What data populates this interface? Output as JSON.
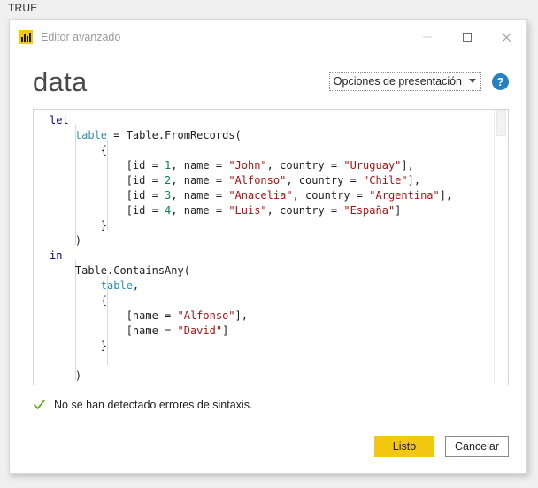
{
  "background": {
    "label": "TRUE"
  },
  "window": {
    "app_icon": "power-bi-bar-chart-icon",
    "title": "Editor avanzado",
    "controls": {
      "minimize": "minimize-icon",
      "maximize": "maximize-icon",
      "close": "close-icon"
    }
  },
  "header": {
    "title": "data",
    "display_options": {
      "label": "Opciones de presentación",
      "caret": "chevron-down-icon"
    },
    "help": {
      "glyph": "?",
      "name": "help-icon"
    }
  },
  "editor": {
    "language": "Power Query M",
    "code_lines": [
      [
        {
          "t": "let",
          "c": "kw"
        }
      ],
      [
        {
          "t": "    ",
          "c": "pl"
        },
        {
          "t": "table",
          "c": "id"
        },
        {
          "t": " = Table.FromRecords(",
          "c": "fn"
        }
      ],
      [
        {
          "t": "        {",
          "c": "pl"
        }
      ],
      [
        {
          "t": "            [id = ",
          "c": "pl"
        },
        {
          "t": "1",
          "c": "num"
        },
        {
          "t": ", name = ",
          "c": "pl"
        },
        {
          "t": "\"John\"",
          "c": "str"
        },
        {
          "t": ", country = ",
          "c": "pl"
        },
        {
          "t": "\"Uruguay\"",
          "c": "str"
        },
        {
          "t": "],",
          "c": "pl"
        }
      ],
      [
        {
          "t": "            [id = ",
          "c": "pl"
        },
        {
          "t": "2",
          "c": "num"
        },
        {
          "t": ", name = ",
          "c": "pl"
        },
        {
          "t": "\"Alfonso\"",
          "c": "str"
        },
        {
          "t": ", country = ",
          "c": "pl"
        },
        {
          "t": "\"Chile\"",
          "c": "str"
        },
        {
          "t": "],",
          "c": "pl"
        }
      ],
      [
        {
          "t": "            [id = ",
          "c": "pl"
        },
        {
          "t": "3",
          "c": "num"
        },
        {
          "t": ", name = ",
          "c": "pl"
        },
        {
          "t": "\"Anacelia\"",
          "c": "str"
        },
        {
          "t": ", country = ",
          "c": "pl"
        },
        {
          "t": "\"Argentina\"",
          "c": "str"
        },
        {
          "t": "],",
          "c": "pl"
        }
      ],
      [
        {
          "t": "            [id = ",
          "c": "pl"
        },
        {
          "t": "4",
          "c": "num"
        },
        {
          "t": ", name = ",
          "c": "pl"
        },
        {
          "t": "\"Luis\"",
          "c": "str"
        },
        {
          "t": ", country = ",
          "c": "pl"
        },
        {
          "t": "\"España\"",
          "c": "str"
        },
        {
          "t": "]",
          "c": "pl"
        }
      ],
      [
        {
          "t": "        }",
          "c": "pl"
        }
      ],
      [
        {
          "t": "    )",
          "c": "pl"
        }
      ],
      [
        {
          "t": "in",
          "c": "kw"
        }
      ],
      [
        {
          "t": "    Table.ContainsAny(",
          "c": "fn"
        }
      ],
      [
        {
          "t": "        ",
          "c": "pl"
        },
        {
          "t": "table",
          "c": "id"
        },
        {
          "t": ",",
          "c": "pl"
        }
      ],
      [
        {
          "t": "        {",
          "c": "pl"
        }
      ],
      [
        {
          "t": "            [name = ",
          "c": "pl"
        },
        {
          "t": "\"Alfonso\"",
          "c": "str"
        },
        {
          "t": "],",
          "c": "pl"
        }
      ],
      [
        {
          "t": "            [name = ",
          "c": "pl"
        },
        {
          "t": "\"David\"",
          "c": "str"
        },
        {
          "t": "]",
          "c": "pl"
        }
      ],
      [
        {
          "t": "        }",
          "c": "pl"
        }
      ],
      [],
      [
        {
          "t": "    )",
          "c": "pl"
        }
      ]
    ],
    "scrollbar": "vertical-scrollbar"
  },
  "status": {
    "icon": "checkmark-icon",
    "message": "No se han detectado errores de sintaxis."
  },
  "footer": {
    "primary_label": "Listo",
    "secondary_label": "Cancelar"
  },
  "colors": {
    "accent": "#f2c811",
    "keyword": "#00007f",
    "identifier": "#2b91af",
    "number": "#098658",
    "string": "#a31515",
    "help_blue": "#2680c2",
    "check_green": "#5aa700",
    "page_bg": "#f0f0f0"
  }
}
